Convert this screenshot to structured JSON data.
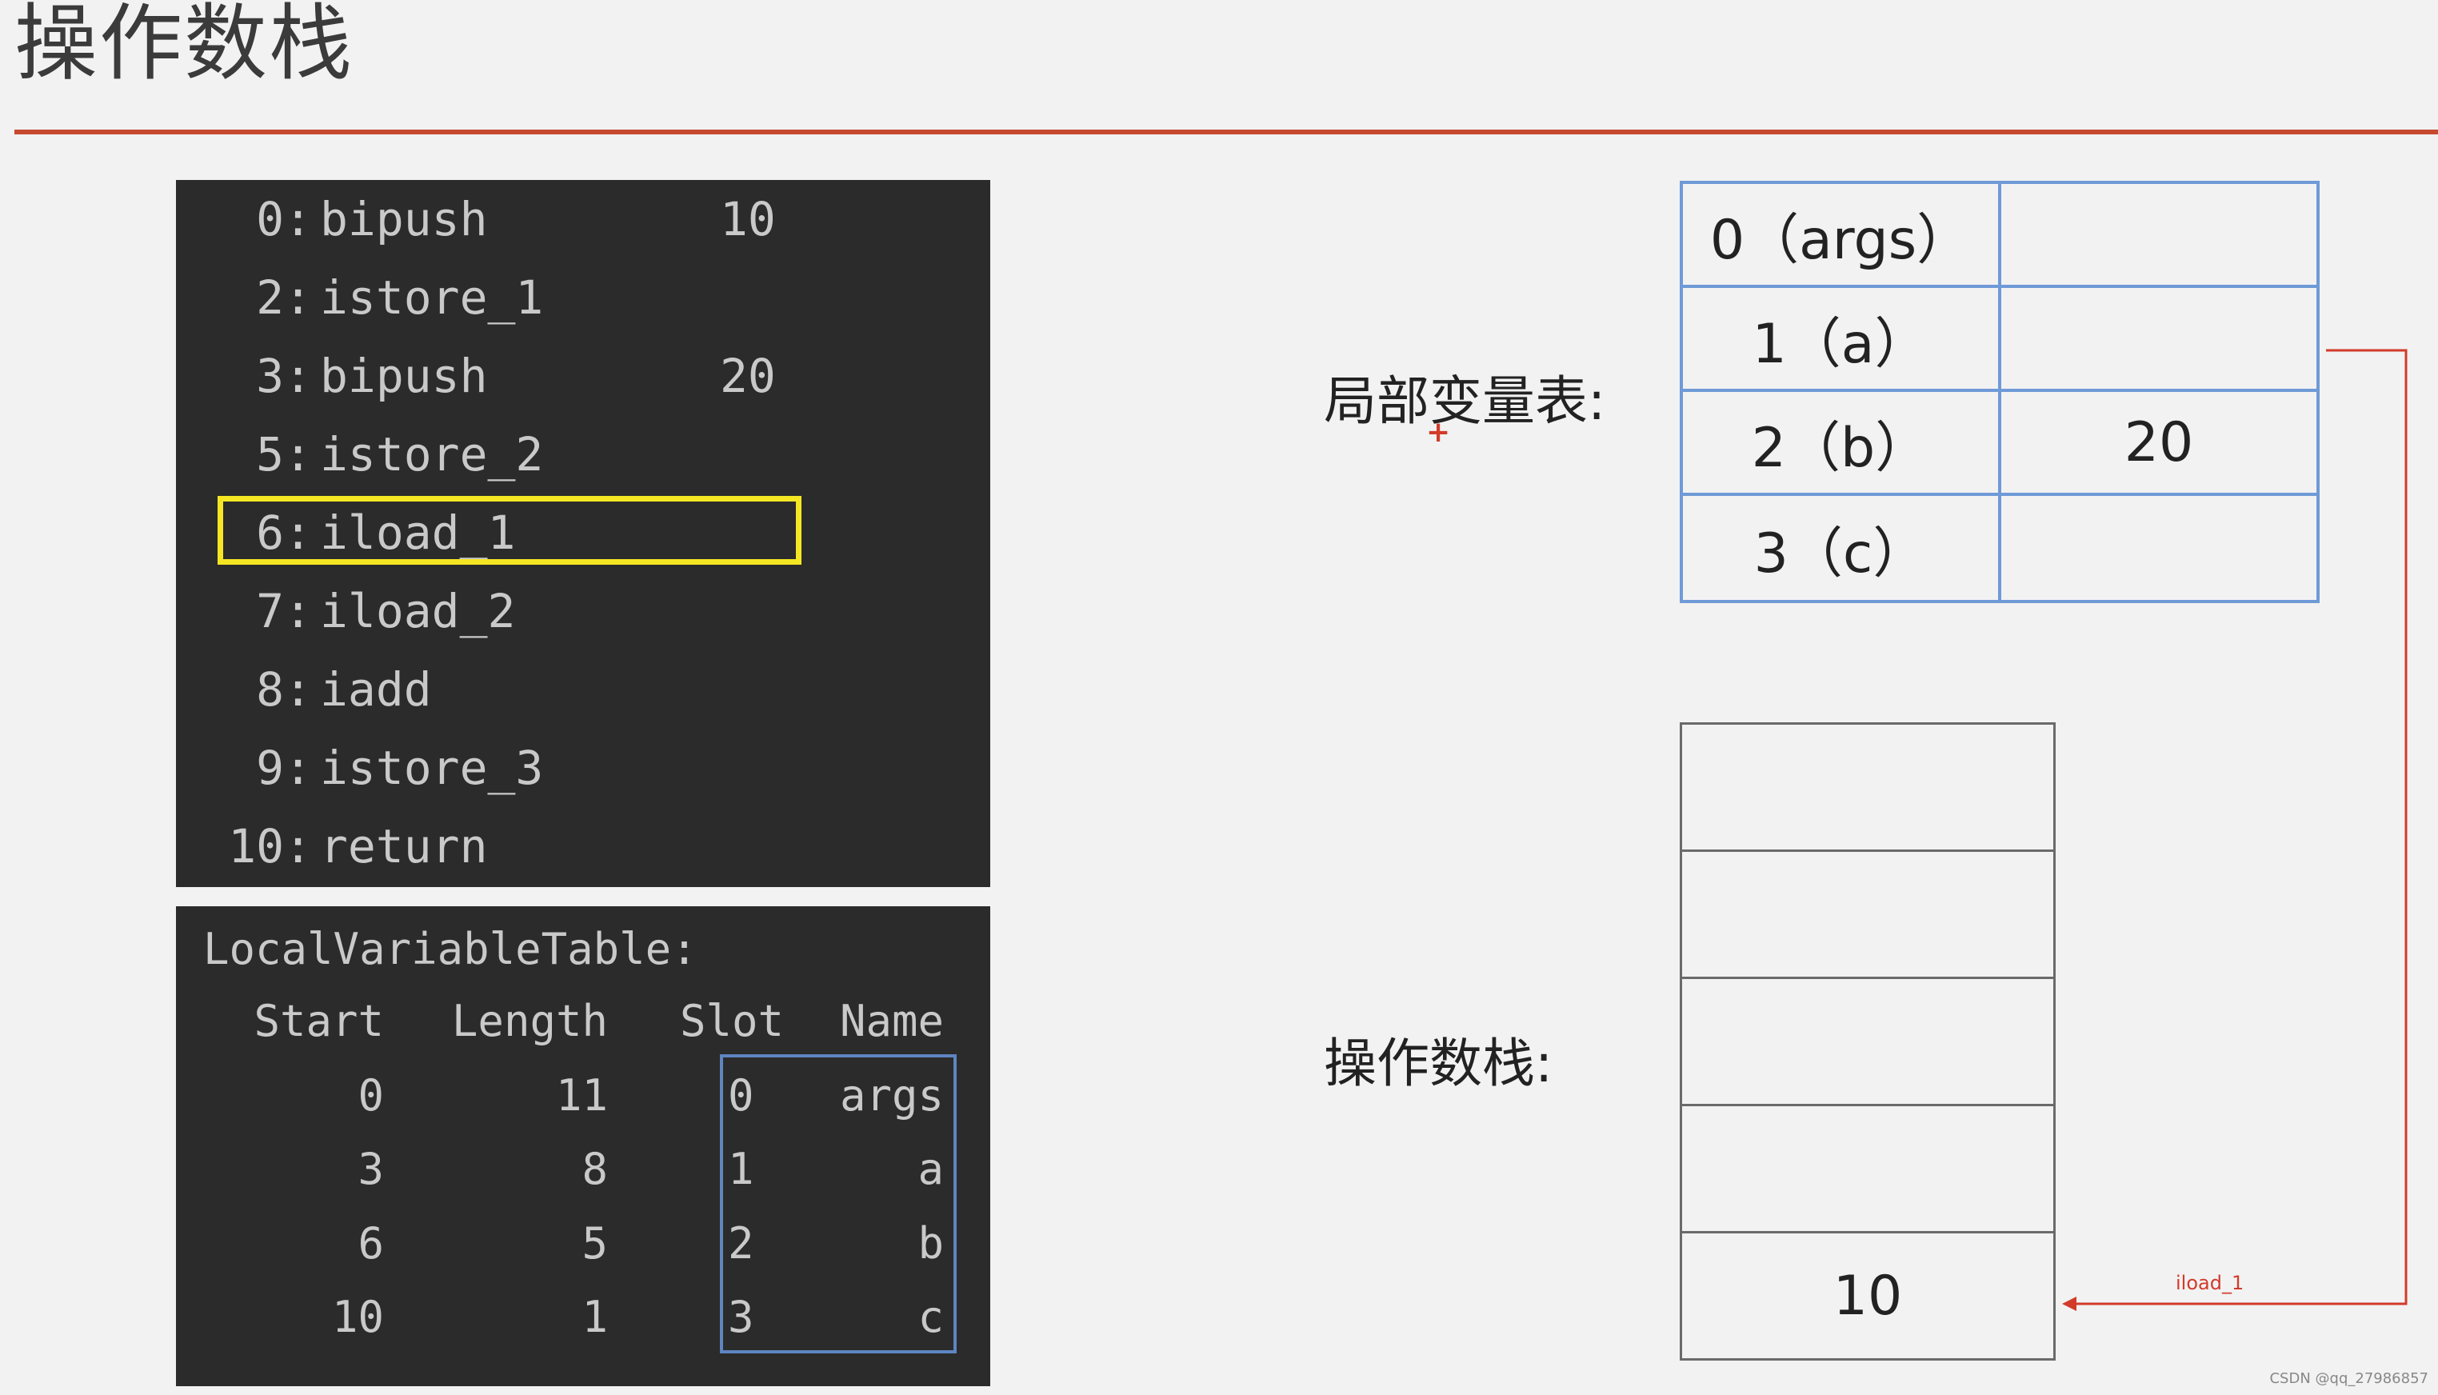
{
  "title": "操作数栈",
  "bytecode": [
    {
      "offset": "0:",
      "op": "bipush",
      "arg": "10"
    },
    {
      "offset": "2:",
      "op": "istore_1",
      "arg": ""
    },
    {
      "offset": "3:",
      "op": "bipush",
      "arg": "20"
    },
    {
      "offset": "5:",
      "op": "istore_2",
      "arg": ""
    },
    {
      "offset": "6:",
      "op": "iload_1",
      "arg": ""
    },
    {
      "offset": "7:",
      "op": "iload_2",
      "arg": ""
    },
    {
      "offset": "8:",
      "op": "iadd",
      "arg": ""
    },
    {
      "offset": "9:",
      "op": "istore_3",
      "arg": ""
    },
    {
      "offset": "10:",
      "op": "return",
      "arg": ""
    }
  ],
  "highlighted_instruction": "6: iload_1",
  "local_variable_table": {
    "title": "LocalVariableTable:",
    "headers": [
      "Start",
      "Length",
      "Slot",
      "Name"
    ],
    "rows": [
      [
        "0",
        "11",
        "0",
        "args"
      ],
      [
        "3",
        "8",
        "1",
        "a"
      ],
      [
        "6",
        "5",
        "2",
        "b"
      ],
      [
        "10",
        "1",
        "3",
        "c"
      ]
    ]
  },
  "locals_label": "局部变量表:",
  "locals": [
    {
      "slot": "0（args）",
      "value": ""
    },
    {
      "slot": "1（a）",
      "value": ""
    },
    {
      "slot": "2（b）",
      "value": "20"
    },
    {
      "slot": "3（c）",
      "value": ""
    }
  ],
  "stack_label": "操作数栈:",
  "stack": [
    "",
    "",
    "",
    "",
    "10"
  ],
  "arrow_label": "iload_1",
  "watermark": "CSDN @qq_27986857",
  "colors": {
    "title_rule": "#c7492f",
    "code_bg": "#2b2b2b",
    "highlight": "#f5e623",
    "table_border": "#6f9ad7",
    "arrow": "#d23b2a"
  }
}
